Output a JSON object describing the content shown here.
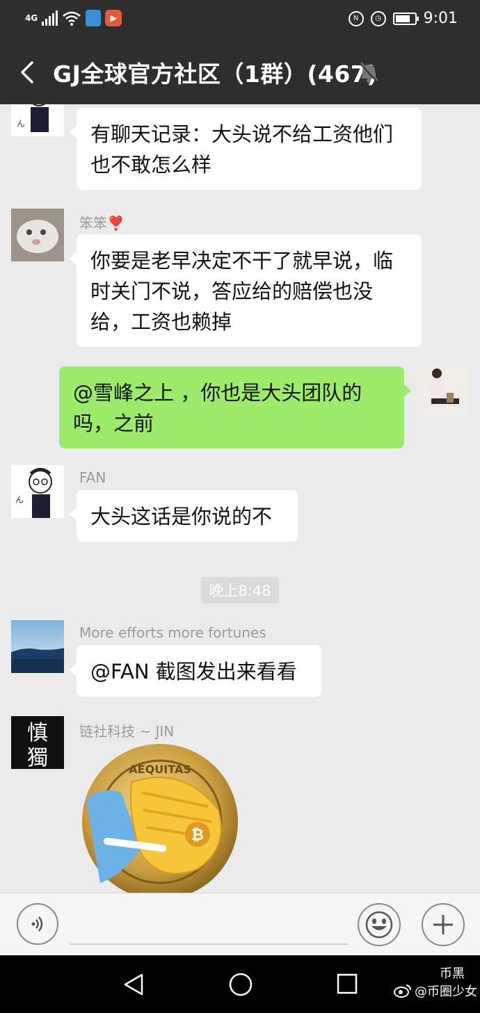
{
  "status_bar": {
    "network": "4G",
    "time": "9:01",
    "icons": [
      "signal-icon",
      "wifi-icon",
      "shield-icon",
      "play-icon",
      "nfc-icon",
      "alarm-icon",
      "battery-icon"
    ]
  },
  "header": {
    "title": "GJ全球官方社区（1群）(467)",
    "icons": [
      "back-arrow-icon",
      "mute-bell-icon"
    ]
  },
  "messages": [
    {
      "sender": "",
      "text": [
        "有聊天记录：大头说不给工资他们",
        "也不敢怎么样"
      ]
    },
    {
      "sender": "笨笨",
      "sender_emoji": "❣️",
      "text": [
        "你要是老早决定不干了就早说，临",
        "时关门不说，答应给的赔偿也没",
        "给，工资也赖掉"
      ]
    },
    {
      "sender": "self",
      "text": [
        "@雪峰之上 ，你也是大头团队的",
        "吗，之前"
      ]
    },
    {
      "sender": "FAN",
      "text": [
        "大头这话是你说的不"
      ]
    },
    {
      "sender": "More efforts  more fortunes",
      "text": [
        "@FAN  截图发出来看看"
      ]
    },
    {
      "sender": "链社科技 ~ JIN",
      "sticker": "facepalm-bitcoin-sticker",
      "sticker_text": "AEQUITAS"
    }
  ],
  "timestamp": "晚上8:48",
  "avatar_text": {
    "jin": "慎獨"
  },
  "input_bar": {
    "icons": [
      "voice-icon",
      "emoji-icon",
      "plus-icon"
    ]
  },
  "nav_bar": {
    "icons": [
      "back-triangle-icon",
      "home-circle-icon",
      "recents-square-icon"
    ]
  },
  "watermark": {
    "line1": "币黑",
    "line2": "@币圈少女"
  },
  "colors": {
    "header": "#2e2e2e",
    "chat_bg": "#ebebeb",
    "green_bubble": "#9eea6a",
    "white_bubble": "#ffffff"
  }
}
